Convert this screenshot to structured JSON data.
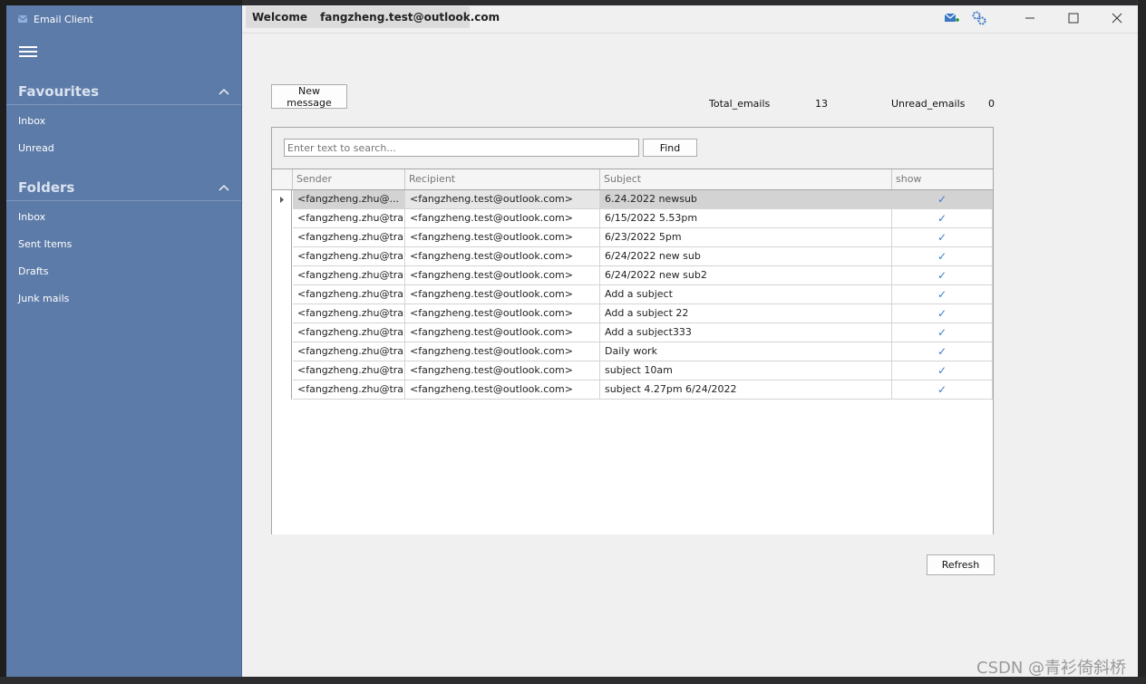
{
  "app": {
    "title": "Email Client",
    "welcome_label": "Welcome",
    "user_email": "fangzheng.test@outlook.com"
  },
  "sidebar": {
    "favourites": {
      "label": "Favourites",
      "items": [
        {
          "label": "Inbox"
        },
        {
          "label": "Unread"
        }
      ]
    },
    "folders": {
      "label": "Folders",
      "items": [
        {
          "label": "Inbox"
        },
        {
          "label": "Sent Items"
        },
        {
          "label": "Drafts"
        },
        {
          "label": "Junk mails"
        }
      ]
    }
  },
  "toolbar": {
    "new_message_label": "New message",
    "find_label": "Find",
    "refresh_label": "Refresh",
    "search_placeholder": "Enter text to search..."
  },
  "stats": {
    "total_label": "Total_emails",
    "total_value": "13",
    "unread_label": "Unread_emails",
    "unread_value": "0"
  },
  "grid": {
    "columns": [
      "Sender",
      "Recipient",
      "Subject",
      "show"
    ],
    "rows": [
      {
        "sender": "<fangzheng.zhu@...",
        "recipient": "<fangzheng.test@outlook.com>",
        "subject": "6.24.2022 newsub",
        "show": "✓"
      },
      {
        "sender": "<fangzheng.zhu@tra...",
        "recipient": "<fangzheng.test@outlook.com>",
        "subject": "6/15/2022 5.53pm",
        "show": "✓"
      },
      {
        "sender": "<fangzheng.zhu@tra...",
        "recipient": "<fangzheng.test@outlook.com>",
        "subject": "6/23/2022 5pm",
        "show": "✓"
      },
      {
        "sender": "<fangzheng.zhu@tra...",
        "recipient": "<fangzheng.test@outlook.com>",
        "subject": "6/24/2022 new sub",
        "show": "✓"
      },
      {
        "sender": "<fangzheng.zhu@tra...",
        "recipient": "<fangzheng.test@outlook.com>",
        "subject": "6/24/2022 new sub2",
        "show": "✓"
      },
      {
        "sender": "<fangzheng.zhu@tra...",
        "recipient": "<fangzheng.test@outlook.com>",
        "subject": "Add a subject",
        "show": "✓"
      },
      {
        "sender": "<fangzheng.zhu@tra...",
        "recipient": "<fangzheng.test@outlook.com>",
        "subject": "Add a subject 22",
        "show": "✓"
      },
      {
        "sender": "<fangzheng.zhu@tra...",
        "recipient": "<fangzheng.test@outlook.com>",
        "subject": "Add a subject333",
        "show": "✓"
      },
      {
        "sender": "<fangzheng.zhu@tra...",
        "recipient": "<fangzheng.test@outlook.com>",
        "subject": "Daily work",
        "show": "✓"
      },
      {
        "sender": "<fangzheng.zhu@tra...",
        "recipient": "<fangzheng.test@outlook.com>",
        "subject": "subject 10am",
        "show": "✓"
      },
      {
        "sender": "<fangzheng.zhu@tra...",
        "recipient": "<fangzheng.test@outlook.com>",
        "subject": "subject 4.27pm 6/24/2022",
        "show": "✓"
      }
    ]
  },
  "colors": {
    "sidebar_bg": "#5d7ba8",
    "window_bg": "#f0f0f0",
    "check_color": "#3a7dd0"
  },
  "watermark": "CSDN @青衫倚斜桥"
}
